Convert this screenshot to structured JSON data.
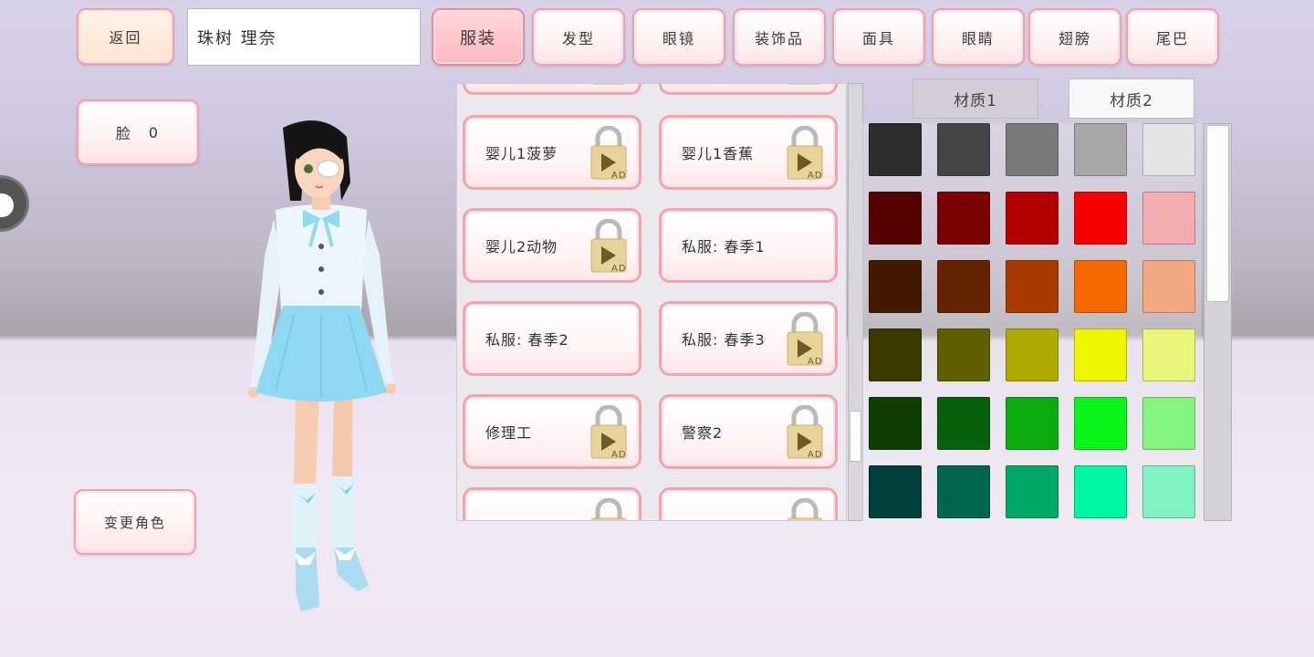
{
  "header": {
    "back_label": "返回",
    "name_value": "珠树 理奈",
    "tabs": [
      {
        "label": "服装",
        "active": true
      },
      {
        "label": "发型"
      },
      {
        "label": "眼镜"
      },
      {
        "label": "装饰品"
      },
      {
        "label": "面具"
      },
      {
        "label": "眼睛"
      },
      {
        "label": "翅膀"
      },
      {
        "label": "尾巴"
      }
    ]
  },
  "left": {
    "face_label": "脸",
    "face_value": "0",
    "change_character_label": "变更角色"
  },
  "outfits": [
    {
      "label": "",
      "locked": true
    },
    {
      "label": "",
      "locked": true
    },
    {
      "label": "婴儿1菠萝",
      "locked": true
    },
    {
      "label": "婴儿1香蕉",
      "locked": true
    },
    {
      "label": "婴儿2动物",
      "locked": true
    },
    {
      "label": "私服: 春季1",
      "locked": false
    },
    {
      "label": "私服: 春季2",
      "locked": false
    },
    {
      "label": "私服: 春季3",
      "locked": true
    },
    {
      "label": "修理工",
      "locked": true
    },
    {
      "label": "警察2",
      "locked": true
    },
    {
      "label": "",
      "locked": true
    },
    {
      "label": "",
      "locked": true
    }
  ],
  "ad_badge": "AD",
  "materials": {
    "tab1": "材质1",
    "tab2": "材质2"
  },
  "palette": [
    [
      "#2d2d2d",
      "#444444",
      "#7a7a7a",
      "#a8a8a8",
      "#e4e4e4"
    ],
    [
      "#560000",
      "#7c0000",
      "#b50000",
      "#f80000",
      "#f3adb0"
    ],
    [
      "#431a00",
      "#652300",
      "#a93a00",
      "#f56a00",
      "#f3a881"
    ],
    [
      "#3d3900",
      "#5f5f00",
      "#aeaa00",
      "#eef500",
      "#eaf57a"
    ],
    [
      "#0f3f00",
      "#05610a",
      "#0aad0d",
      "#0af51a",
      "#85f47e"
    ],
    [
      "#00403a",
      "#006650",
      "#00a967",
      "#00f5a4",
      "#7ff4c2"
    ]
  ]
}
